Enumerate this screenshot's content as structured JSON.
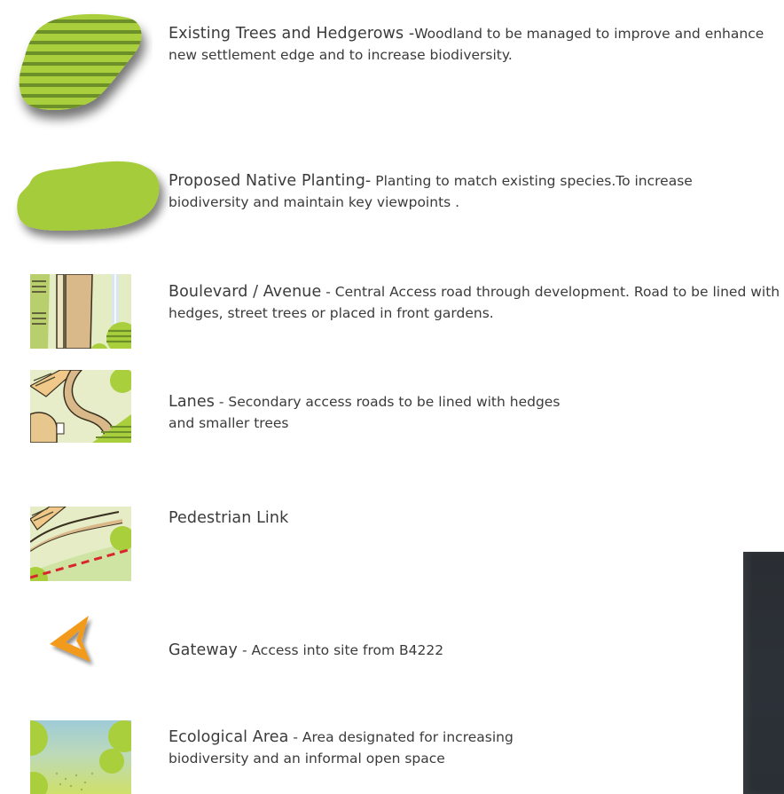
{
  "legend": {
    "items": [
      {
        "key": "existing-trees",
        "heading": "Existing Trees and Hedgerows -",
        "description": "Woodland to be managed to improve and enhance new settlement edge and to increase biodiversity."
      },
      {
        "key": "native-planting",
        "heading": "Proposed Native Planting-",
        "description": " Planting to match existing species.To increase biodiversity and maintain key viewpoints ."
      },
      {
        "key": "boulevard",
        "heading": "Boulevard / Avenue",
        "description": " - Central Access road through development. Road to be lined with hedges, street trees or placed in front gardens."
      },
      {
        "key": "lanes",
        "heading": "Lanes",
        "description": " - Secondary access roads to be lined with hedges and smaller trees"
      },
      {
        "key": "pedestrian-link",
        "heading": "Pedestrian Link",
        "description": ""
      },
      {
        "key": "gateway",
        "heading": "Gateway",
        "description": " - Access into site from B4222"
      },
      {
        "key": "ecological-area",
        "heading": "Ecological Area",
        "description": " - Area designated for increasing biodiversity and an informal open space"
      }
    ]
  },
  "colors": {
    "grass_green": "#a9cf3c",
    "stripe_green": "#6d8f2a",
    "road_tan": "#d9b98a",
    "gateway_orange": "#f29a1e",
    "link_red": "#d8262c",
    "water_blue": "#9ecbd8",
    "panel_dark": "#2b3036"
  }
}
